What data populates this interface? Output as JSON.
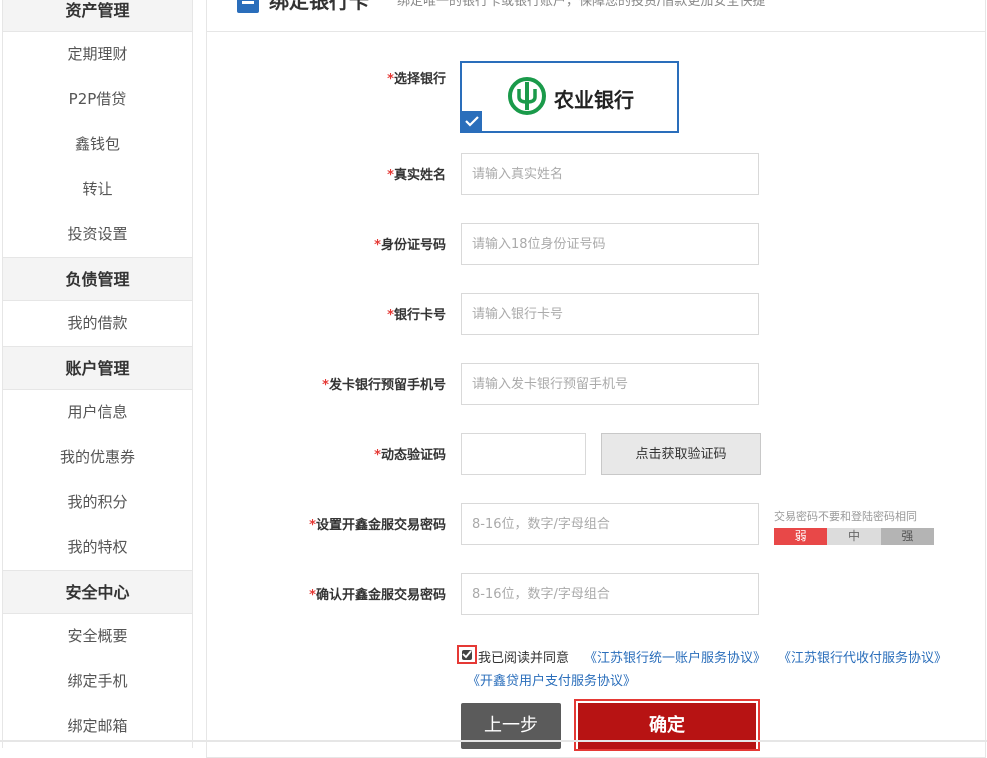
{
  "sidebar": {
    "sections": [
      {
        "title": "资产管理",
        "items": [
          "定期理财",
          "P2P借贷",
          "鑫钱包",
          "转让",
          "投资设置"
        ]
      },
      {
        "title": "负债管理",
        "items": [
          "我的借款"
        ]
      },
      {
        "title": "账户管理",
        "items": [
          "用户信息",
          "我的优惠券",
          "我的积分",
          "我的特权"
        ]
      },
      {
        "title": "安全中心",
        "items": [
          "安全概要",
          "绑定手机",
          "绑定邮箱"
        ]
      }
    ]
  },
  "header": {
    "title": "绑定银行卡",
    "desc": "绑定唯一的银行卡或银行账户，保障您的投资/借款更加安全快捷"
  },
  "form": {
    "required_mark": "*",
    "bank_label": "选择银行",
    "bank_name": "农业银行",
    "name_label": "真实姓名",
    "name_placeholder": "请输入真实姓名",
    "id_label": "身份证号码",
    "id_placeholder": "请输入18位身份证号码",
    "card_label": "银行卡号",
    "card_placeholder": "请输入银行卡号",
    "phone_label": "发卡银行预留手机号",
    "phone_placeholder": "请输入发卡银行预留手机号",
    "code_label": "动态验证码",
    "code_button": "点击获取验证码",
    "pw_label": "设置开鑫金服交易密码",
    "pw_placeholder": "8-16位，数字/字母组合",
    "pw_hint": "交易密码不要和登陆密码相同",
    "strength": {
      "weak": "弱",
      "mid": "中",
      "strong": "强"
    },
    "pw_confirm_label": "确认开鑫金服交易密码",
    "pw_confirm_placeholder": "8-16位，数字/字母组合"
  },
  "agreement": {
    "text": "我已阅读并同意",
    "link1": "《江苏银行统一账户服务协议》",
    "link2": "《江苏银行代收付服务协议》",
    "link3": "《开鑫贷用户支付服务协议》"
  },
  "buttons": {
    "prev": "上一步",
    "ok": "确定"
  },
  "colors": {
    "accent": "#2a6ebb",
    "danger": "#b71313",
    "required": "#e53935",
    "bank_green": "#1a9a4a"
  },
  "icons": {
    "bank_logo": "abc-bank-logo-icon",
    "check": "check-icon",
    "section": "card-icon"
  }
}
